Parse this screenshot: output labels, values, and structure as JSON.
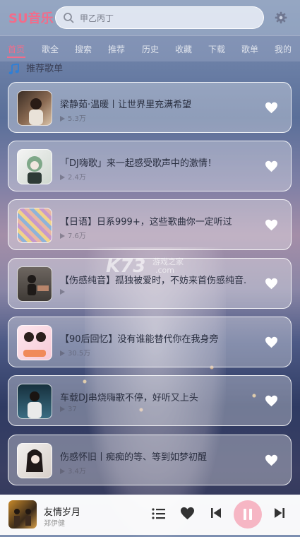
{
  "app": {
    "logo": "SU音乐"
  },
  "search": {
    "placeholder": "甲乙丙丁"
  },
  "tabs": [
    {
      "label": "首页",
      "active": true
    },
    {
      "label": "歌全"
    },
    {
      "label": "搜索"
    },
    {
      "label": "推荐"
    },
    {
      "label": "历史"
    },
    {
      "label": "收藏"
    },
    {
      "label": "下载"
    },
    {
      "label": "歌单"
    },
    {
      "label": "我的"
    }
  ],
  "section": {
    "title": "推荐歌单"
  },
  "playlists": [
    {
      "title": "梁静茹·温暖丨让世界里充满希望",
      "plays": "5.3万"
    },
    {
      "title": "「DJ嗨歌」来一起感受歌声中的激情！",
      "plays": "2.4万"
    },
    {
      "title": "【日语】日系999+，这些歌曲你一定听过",
      "plays": "7.6万"
    },
    {
      "title": "【伤感纯音】孤独被爱时，不妨来首伤感纯音.",
      "plays": ""
    },
    {
      "title": "【90后回忆】没有谁能替代你在我身旁",
      "plays": "30.5万"
    },
    {
      "title": "车载DJ串烧嗨歌不停，好听又上头",
      "plays": "37"
    },
    {
      "title": "伤感怀旧丨痴痴的等、等到如梦初醒",
      "plays": "3.4万"
    }
  ],
  "player": {
    "title": "友情岁月",
    "artist": "郑伊健"
  },
  "watermark": {
    "text": "K73",
    "sub": "游戏之家",
    "domain": ".com"
  },
  "colors": {
    "accent": "#f26c8a",
    "pause_bg": "#f6b6c4"
  }
}
